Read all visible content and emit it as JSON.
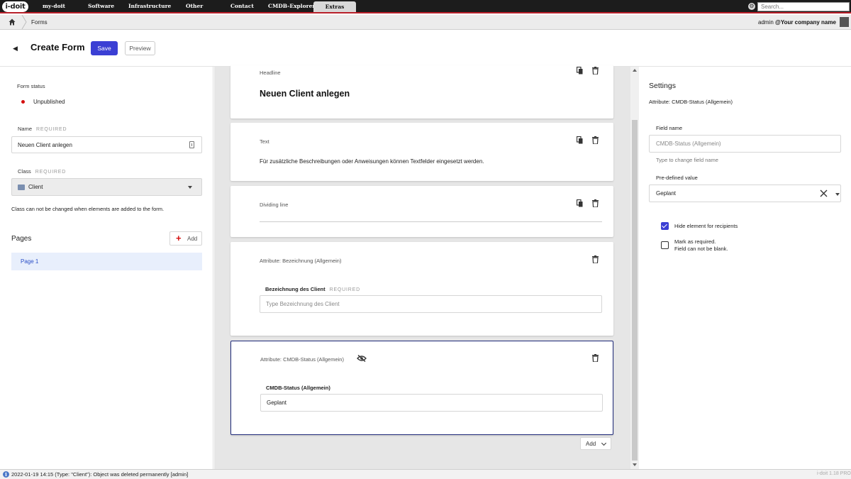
{
  "app": {
    "logo": "i-doit",
    "nav": [
      "my-doit",
      "Software",
      "Infrastructure",
      "Other",
      "Contact",
      "CMDB-Explorer",
      "Extras"
    ],
    "active_nav": "Extras",
    "search_placeholder": "Search...",
    "breadcrumb": "Forms",
    "user_name": "admin",
    "company": "@Your company name"
  },
  "header": {
    "title": "Create Form",
    "save_label": "Save",
    "preview_label": "Preview"
  },
  "left": {
    "status_label": "Form status",
    "status_value": "Unpublished",
    "name_label": "Name",
    "required": "REQUIRED",
    "name_value": "Neuen Client anlegen",
    "class_label": "Class",
    "class_value": "Client",
    "class_hint": "Class can not be changed when elements are added to the form.",
    "pages_title": "Pages",
    "add_label": "Add",
    "pages": [
      "Page 1"
    ]
  },
  "canvas": {
    "headline_label": "Headline",
    "headline_text": "Neuen Client anlegen",
    "text_label": "Text",
    "text_body": "Für zusätzliche Beschreibungen oder Anweisungen können Textfelder eingesetzt werden.",
    "divider_label": "Dividing line",
    "attr1_label": "Attribute: Bezeichnung (Allgemein)",
    "attr1_field": "Bezeichnung des Client",
    "attr1_required": "REQUIRED",
    "attr1_placeholder": "Type Bezeichnung des Client",
    "attr2_label": "Attribute: CMDB-Status (Allgemein)",
    "attr2_field": "CMDB-Status (Allgemein)",
    "attr2_value": "Geplant",
    "add_element": "Add"
  },
  "settings": {
    "title": "Settings",
    "subtitle": "Attribute: CMDB-Status (Allgemein)",
    "field_name_label": "Field name",
    "field_name_placeholder": "CMDB-Status (Allgemein)",
    "field_name_hint": "Type to change field name",
    "predef_label": "Pre-defined value",
    "predef_value": "Geplant",
    "hide_label": "Hide element for recipients",
    "hide_checked": true,
    "required_label": "Mark as required.",
    "required_hint": "Field can not be blank.",
    "required_checked": false
  },
  "footer": {
    "message": "2022-01-19 14:15 (Type: \"Client\"): Object was deleted permanently [admin]",
    "version": "i-doit 1.18 PRO"
  },
  "colors": {
    "accent": "#3b3fd4",
    "nav_bg": "#1c1c1c",
    "nav_border": "#b8202a",
    "status_unpublished": "#d40f0f",
    "selected_border": "#1f2a7a"
  },
  "icons": [
    "home-icon",
    "back-icon",
    "clipboard-icon",
    "class-icon",
    "plus-icon",
    "copy-icon",
    "trash-icon",
    "eye-off-icon",
    "chevron-down-icon",
    "close-icon",
    "info-icon",
    "gear-icon",
    "avatar"
  ]
}
